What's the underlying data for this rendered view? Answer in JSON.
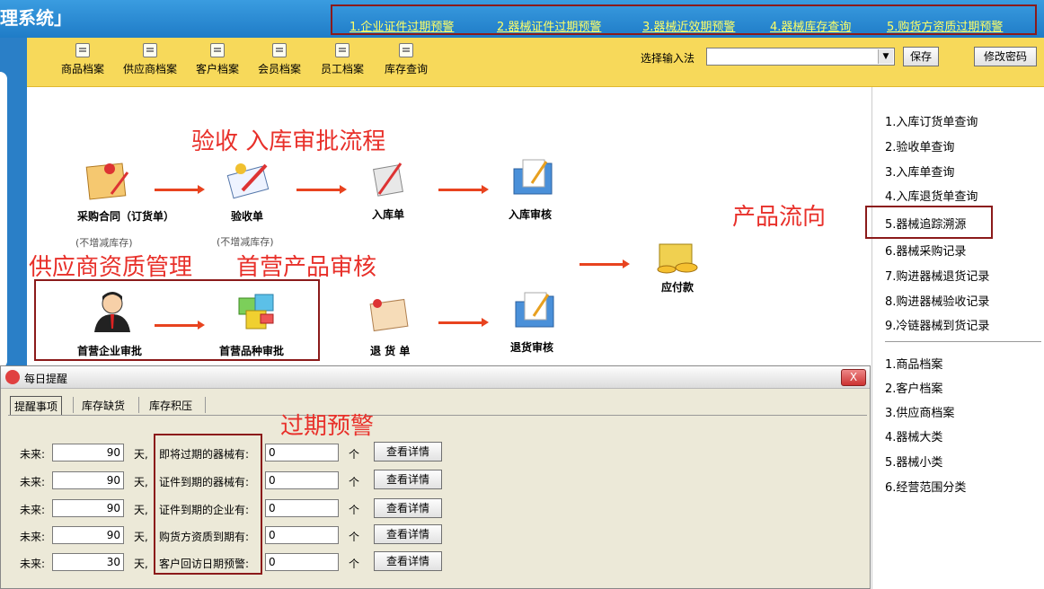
{
  "header": {
    "title": "理系统」",
    "alerts": [
      "1.企业证件过期预警",
      "2.器械证件过期预警",
      "3.器械近效期预警",
      "4.器械库存查询",
      "5.购货方资质过期预警"
    ]
  },
  "toolbar": {
    "buttons": [
      "商品档案",
      "供应商档案",
      "客户档案",
      "会员档案",
      "员工档案",
      "库存查询"
    ],
    "ime_label": "选择输入法",
    "ime_value": "",
    "save_label": "保存",
    "change_password_label": "修改密码"
  },
  "workflow": {
    "title_acceptance": "验收 入库审批流程",
    "title_supplier": "供应商资质管理",
    "title_first_product": "首营产品审核",
    "title_flow": "产品流向",
    "nodes": {
      "purchase_contract": "采购合同（订货单）",
      "acceptance": "验收单",
      "warehousing": "入库单",
      "warehousing_review": "入库审核",
      "first_enterprise": "首营企业审批",
      "first_variety": "首营品种审批",
      "return": "退 货 单",
      "return_review": "退货审核",
      "payable": "应付款"
    },
    "note_no_stock_1": "(不增减库存)",
    "note_no_stock_2": "(不增减库存)"
  },
  "right_panel": {
    "group1": [
      "1.入库订货单查询",
      "2.验收单查询",
      "3.入库单查询",
      "4.入库退货单查询",
      "5.器械追踪溯源",
      "6.器械采购记录",
      "7.购进器械退货记录",
      "8.购进器械验收记录",
      "9.冷链器械到货记录"
    ],
    "group2": [
      "1.商品档案",
      "2.客户档案",
      "3.供应商档案",
      "4.器械大类",
      "5.器械小类",
      "6.经营范围分类"
    ]
  },
  "dialog": {
    "title": "每日提醒",
    "close_label": "X",
    "tabs": [
      "提醒事项",
      "库存缺货",
      "库存积压"
    ],
    "warning_title": "过期预警",
    "future_label": "未来:",
    "day_label": "天,",
    "unit_label": "个",
    "detail_label": "查看详情",
    "rows": [
      {
        "days": "90",
        "label": "即将过期的器械有:",
        "value": "0"
      },
      {
        "days": "90",
        "label": "证件到期的器械有:",
        "value": "0"
      },
      {
        "days": "90",
        "label": "证件到期的企业有:",
        "value": "0"
      },
      {
        "days": "90",
        "label": "购货方资质到期有:",
        "value": "0"
      },
      {
        "days": "30",
        "label": "客户回访日期预警:",
        "value": "0"
      }
    ]
  }
}
